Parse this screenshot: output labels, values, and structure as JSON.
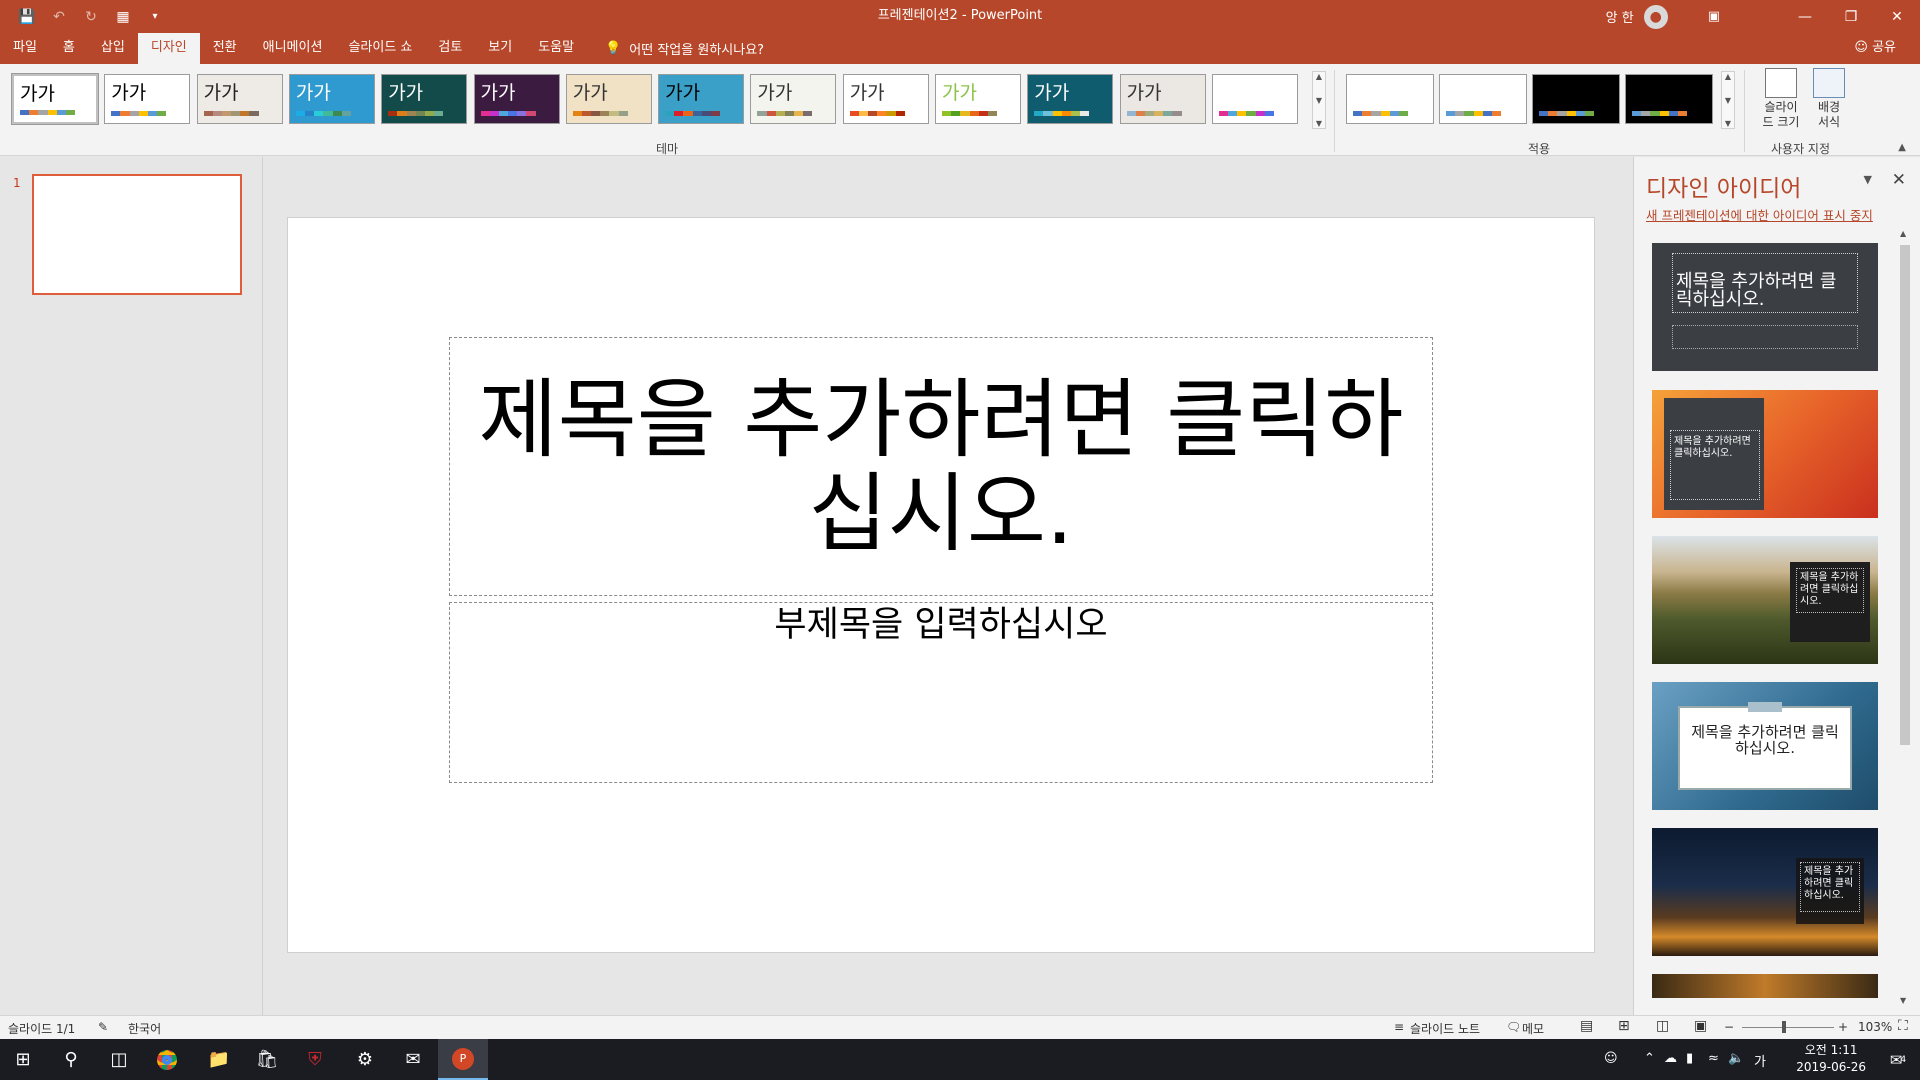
{
  "window": {
    "document_title": "프레젠테이션2  -  PowerPoint",
    "user_name": "앙 한"
  },
  "menu": {
    "tabs": [
      "파일",
      "홈",
      "삽입",
      "디자인",
      "전환",
      "애니메이션",
      "슬라이드 쇼",
      "검토",
      "보기",
      "도움말"
    ],
    "active_tab": "디자인",
    "tell_me": "어떤 작업을 원하시나요?",
    "share": "공유"
  },
  "ribbon": {
    "theme_sample_text": "가가",
    "themes_group_label": "테마",
    "variants_group_label": "적용",
    "customize_group_label": "사용자 지정",
    "slide_size_label": "슬라이드 크기",
    "format_bg_label": "배경 서식",
    "themes": [
      {
        "bg": "#ffffff",
        "fg": "#000000",
        "bars": [
          "#4472c4",
          "#ed7d31",
          "#a5a5a5",
          "#ffc000",
          "#5b9bd5",
          "#70ad47"
        ]
      },
      {
        "bg": "#ffffff",
        "fg": "#000000",
        "bars": [
          "#4472c4",
          "#ed7d31",
          "#a5a5a5",
          "#ffc000",
          "#5b9bd5",
          "#70ad47"
        ]
      },
      {
        "bg": "#eeeae5",
        "fg": "#222222",
        "bars": [
          "#a5644e",
          "#b58b80",
          "#c3986d",
          "#a19574",
          "#c17529",
          "#7a6a60"
        ]
      },
      {
        "bg": "#2e9ad0",
        "fg": "#ffffff",
        "bars": [
          "#1cade4",
          "#2683c6",
          "#27ced7",
          "#42ba97",
          "#3e8853",
          "#62a39f"
        ]
      },
      {
        "bg": "#134a4a",
        "fg": "#ffffff",
        "bars": [
          "#a53010",
          "#de7e18",
          "#9f8351",
          "#728653",
          "#92aa4c",
          "#6aac91"
        ]
      },
      {
        "bg": "#3b1b3f",
        "fg": "#ffffff",
        "bars": [
          "#e32d91",
          "#c830cc",
          "#4ea6dc",
          "#4775e7",
          "#8971e1",
          "#d54773"
        ]
      },
      {
        "bg": "#f1e2c6",
        "fg": "#333333",
        "bars": [
          "#e48312",
          "#bd582c",
          "#865640",
          "#9b8357",
          "#c2bc80",
          "#94a088"
        ]
      },
      {
        "bg": "#3aa0c8",
        "fg": "#000000",
        "bars": [
          "#2da2bf",
          "#da1f28",
          "#eb641b",
          "#39639d",
          "#474b78",
          "#7d3c4a"
        ]
      },
      {
        "bg": "#f4f4ee",
        "fg": "#333333",
        "bars": [
          "#93a299",
          "#cf543f",
          "#b5ae53",
          "#848058",
          "#e8b54d",
          "#786c71"
        ]
      },
      {
        "bg": "#ffffff",
        "fg": "#333333",
        "bars": [
          "#e84c22",
          "#ffbd47",
          "#b64926",
          "#ff8427",
          "#cc9900",
          "#b22600"
        ]
      },
      {
        "bg": "#ffffff",
        "fg": "#8bc34a",
        "bars": [
          "#90c226",
          "#54a021",
          "#e6b91e",
          "#e76618",
          "#c42f1a",
          "#918655"
        ]
      },
      {
        "bg": "#0f5c6e",
        "fg": "#ffffff",
        "bars": [
          "#21a9c7",
          "#6ec1d8",
          "#ffc000",
          "#ff8a00",
          "#a7c14c",
          "#e8e8e8"
        ]
      },
      {
        "bg": "#ebe8e4",
        "fg": "#333333",
        "bars": [
          "#94b6d2",
          "#dd8047",
          "#a5ab81",
          "#d8b25c",
          "#7ba79d",
          "#968c8c"
        ]
      },
      {
        "bg": "#ffffff",
        "fg": "#ffffff",
        "bars": [
          "#e32d91",
          "#4ea6dc",
          "#ffc000",
          "#70ad47",
          "#c830cc",
          "#4775e7"
        ]
      }
    ],
    "variants": [
      {
        "bg": "#ffffff",
        "bars": [
          "#4472c4",
          "#ed7d31",
          "#a5a5a5",
          "#ffc000",
          "#5b9bd5",
          "#70ad47"
        ]
      },
      {
        "bg": "#ffffff",
        "bars": [
          "#5b9bd5",
          "#a5a5a5",
          "#70ad47",
          "#ffc000",
          "#4472c4",
          "#ed7d31"
        ]
      },
      {
        "bg": "#000000",
        "bars": [
          "#4472c4",
          "#ed7d31",
          "#a5a5a5",
          "#ffc000",
          "#5b9bd5",
          "#70ad47"
        ]
      },
      {
        "bg": "#000000",
        "bars": [
          "#5b9bd5",
          "#a5a5a5",
          "#70ad47",
          "#ffc000",
          "#4472c4",
          "#ed7d31"
        ]
      }
    ]
  },
  "thumbnails": {
    "slide_number": "1"
  },
  "slide": {
    "title_placeholder": "제목을 추가하려면 클릭하십시오.",
    "subtitle_placeholder": "부제목을 입력하십시오"
  },
  "design_ideas": {
    "title": "디자인 아이디어",
    "stop_link": "새 프레젠테이션에 대한 아이디어 표시 중지",
    "idea1_title": "제목을 추가하려면 클릭하십시오.",
    "idea2_title": "제목을 추가하려면 클릭하십시오.",
    "idea3_title": "제목을 추가하려면 클릭하십시오.",
    "idea4_title": "제목을 추가하려면 클릭하십시오.",
    "idea5_title": "제목을 추가하려면 클릭하십시오."
  },
  "statusbar": {
    "slide_count": "슬라이드 1/1",
    "language": "한국어",
    "notes": "슬라이드 노트",
    "comments": "메모",
    "zoom": "103%"
  },
  "taskbar": {
    "time": "오전 1:11",
    "date": "2019-06-26",
    "ime": "가",
    "notification_count": "4"
  }
}
